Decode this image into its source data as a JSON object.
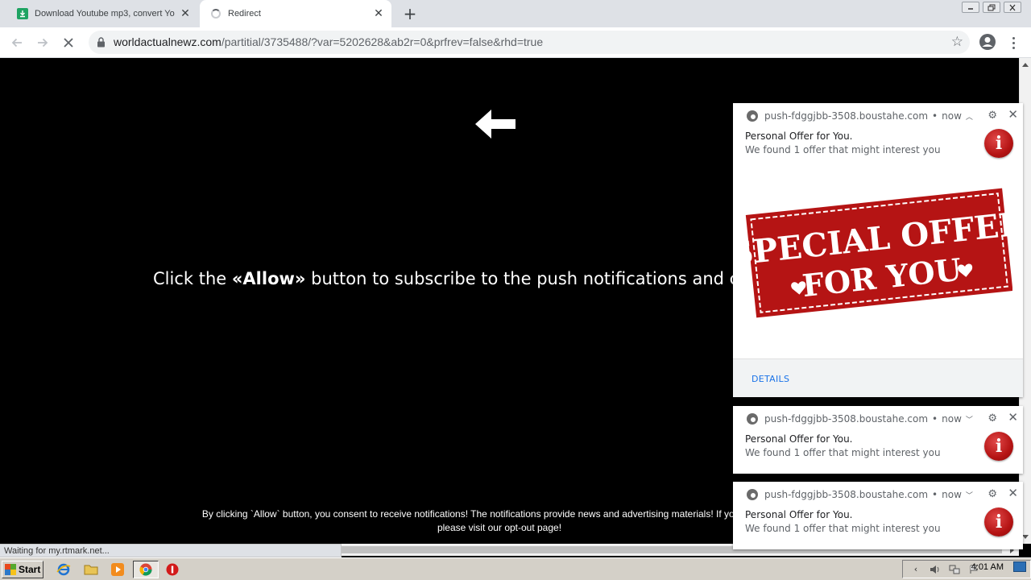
{
  "browser": {
    "tabs": [
      {
        "title": "Download Youtube mp3, convert Yo",
        "close_label": "✕"
      },
      {
        "title": "Redirect",
        "close_label": "✕"
      }
    ],
    "new_tab_label": "+",
    "url_host": "worldactualnewz.com",
    "url_path": "/partitial/3735488/?var=5202628&ab2r=0&prfrev=false&rhd=true",
    "status_text": "Waiting for my.rtmark.net..."
  },
  "page": {
    "headline_before": "Click the ",
    "headline_bold": "«Allow»",
    "headline_after": " button to subscribe to the push notifications and c",
    "consent_line1": "By clicking `Allow` button, you consent to receive notifications! The notifications provide news and advertising materials! If you do not agree",
    "consent_line2_prefix": "please visit our ",
    "consent_optout": "opt-out page!",
    "arrow_icon": "arrow-left-icon"
  },
  "notifications": [
    {
      "origin": "push-fdggjbb-3508.boustahe.com",
      "time": "now",
      "expanded": true,
      "title": "Personal Offer for You.",
      "body": "We found 1 offer that might interest you",
      "image_line1": "SPECIAL OFFER",
      "image_line2": "FOR YOU",
      "details_label": "DETAILS"
    },
    {
      "origin": "push-fdggjbb-3508.boustahe.com",
      "time": "now",
      "expanded": false,
      "title": "Personal Offer for You.",
      "body": "We found 1 offer that might interest you"
    },
    {
      "origin": "push-fdggjbb-3508.boustahe.com",
      "time": "now",
      "expanded": false,
      "title": "Personal Offer for You.",
      "body": "We found 1 offer that might interest you"
    }
  ],
  "taskbar": {
    "start_label": "Start",
    "clock": "4:01 AM"
  },
  "colors": {
    "accent_blue": "#1a73e8",
    "offer_red": "#b51414",
    "page_bg": "#000000"
  }
}
